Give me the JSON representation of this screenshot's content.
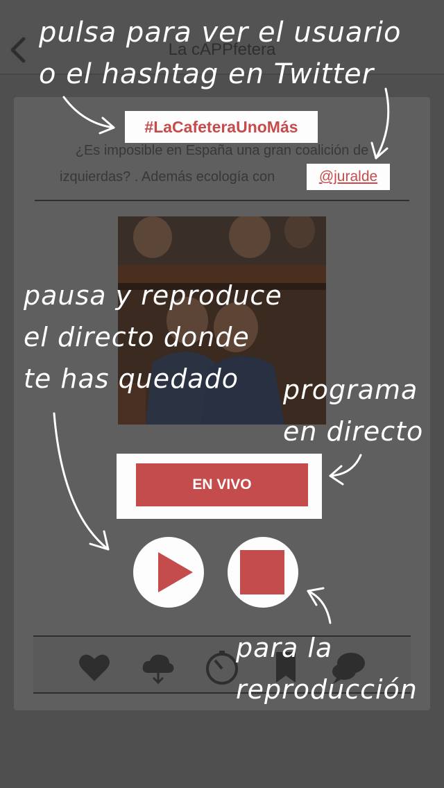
{
  "nav": {
    "title": "La cAPPfetera",
    "back_icon": "chevron-left-icon"
  },
  "episode": {
    "hashtag": "#LaCafeteraUnoMás",
    "description_line1": "¿Es imposible en España una gran coalición de",
    "description_line2": "izquierdas? . Además ecología con",
    "mention": "@juralde"
  },
  "player": {
    "live_label": "EN VIVO",
    "play_icon": "play-icon",
    "stop_icon": "stop-icon"
  },
  "toolbar": {
    "icons": [
      "heart-icon",
      "cloud-download-icon",
      "timer-icon",
      "bookmark-icon",
      "chat-bubbles-icon"
    ]
  },
  "annotations": {
    "top_line1": "pulsa para ver el usuario",
    "top_line2": "o el hashtag en Twitter",
    "pause_line1": "pausa y reproduce",
    "pause_line2": "el directo donde",
    "pause_line3": "te has quedado",
    "live_line1": "programa",
    "live_line2": "en directo",
    "stop_line1": "para la",
    "stop_line2": "reproducción"
  },
  "colors": {
    "accent_red": "#c54c4c",
    "overlay_gray": "#4f4f4f",
    "highlight_white": "#fdfdfd"
  }
}
